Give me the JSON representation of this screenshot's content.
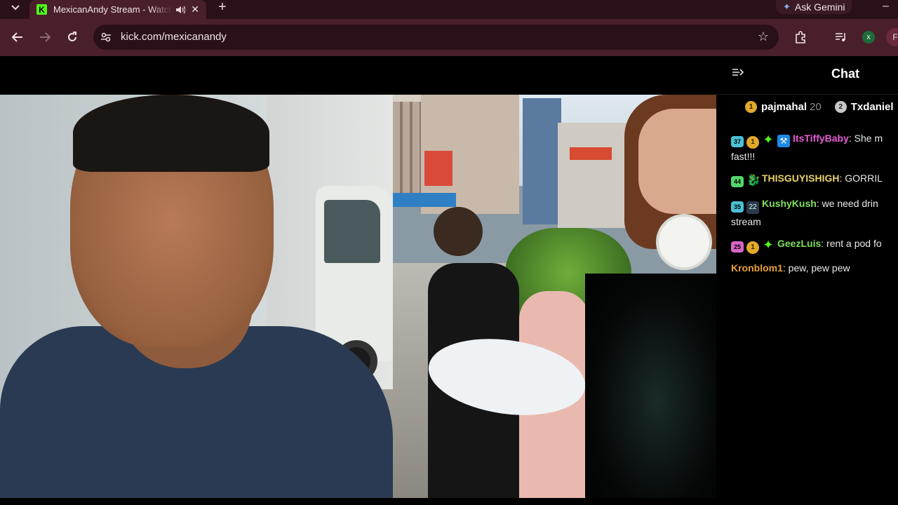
{
  "browser": {
    "tab_title": "MexicanAndy Stream - Watch Live on Kick",
    "tab_favicon_letter": "K",
    "tab_close": "✕",
    "new_tab": "+",
    "ask_gemini": "Ask Gemini",
    "url": "kick.com/mexicanandy",
    "extension_avatar": "x",
    "profile_initial": "F",
    "window_minimize": "–",
    "icons": {
      "tab_dropdown": "chevron-down-icon",
      "audio": "speaker-icon",
      "back": "back-arrow-icon",
      "forward": "forward-arrow-icon",
      "reload": "reload-icon",
      "site_info": "tune-icon",
      "bookmark": "star-icon",
      "extensions": "puzzle-icon",
      "media": "media-controls-icon"
    }
  },
  "chat": {
    "title": "Chat",
    "leaderboard": [
      {
        "rank": "1",
        "name": "pajmahal",
        "count": "20"
      },
      {
        "rank": "2",
        "name": "Txdaniel",
        "count": ""
      }
    ],
    "messages": [
      {
        "badges": [
          "37",
          "1",
          "✦",
          "⚒"
        ],
        "username": "ItsTiffyBaby",
        "username_color": "#e85dd6",
        "text": "She m fast!!!"
      },
      {
        "badges": [
          "44",
          "🐉"
        ],
        "username": "THISGUYISHIGH",
        "username_color": "#e7d36a",
        "text": "GORRIL"
      },
      {
        "badges": [
          "35",
          "22"
        ],
        "username": "KushyKush",
        "username_color": "#7ee05c",
        "text": "we need drin stream"
      },
      {
        "badges": [
          "25",
          "1",
          "✦"
        ],
        "username": "GeezLuis",
        "username_color": "#7ee05c",
        "text": "rent a pod fo"
      },
      {
        "badges": [],
        "username": "Kronblom1",
        "username_color": "#e8a13a",
        "text": "pew, pew pew"
      }
    ]
  },
  "colors": {
    "kick_green": "#53fc18",
    "chrome_dark": "#2a1019",
    "chrome_toolbar": "#4a1f2c"
  }
}
